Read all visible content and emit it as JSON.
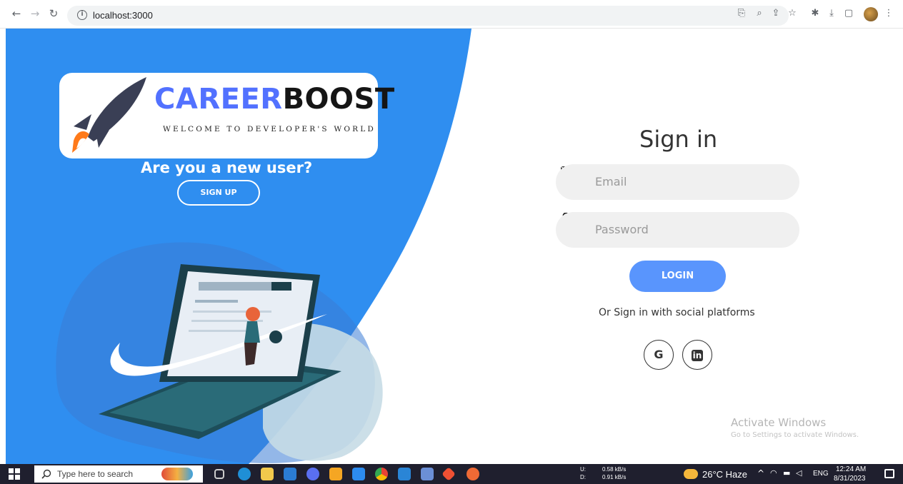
{
  "browser": {
    "url": "localhost:3000"
  },
  "left_panel": {
    "logo_part1": "CAREER",
    "logo_part2": "BOOST",
    "logo_tagline": "WELCOME TO DEVELOPER'S WORLD",
    "new_user_text": "Are you a new user?",
    "signup_label": "SIGN UP",
    "accent_color": "#3b8ff0"
  },
  "signin": {
    "title": "Sign in",
    "email_placeholder": "Email",
    "password_placeholder": "Password",
    "login_label": "LOGIN",
    "social_text": "Or Sign in with social platforms",
    "google_label": "G",
    "linkedin_label": "in"
  },
  "watermark": {
    "line1": "Activate Windows",
    "line2": "Go to Settings to activate Windows."
  },
  "taskbar": {
    "search_placeholder": "Type here to search",
    "net_up_label": "U:",
    "net_up_value": "0.58 kB/s",
    "net_down_label": "D:",
    "net_down_value": "0.91 kB/s",
    "weather": "26°C Haze",
    "language": "ENG",
    "time": "12:24 AM",
    "date": "8/31/2023"
  }
}
